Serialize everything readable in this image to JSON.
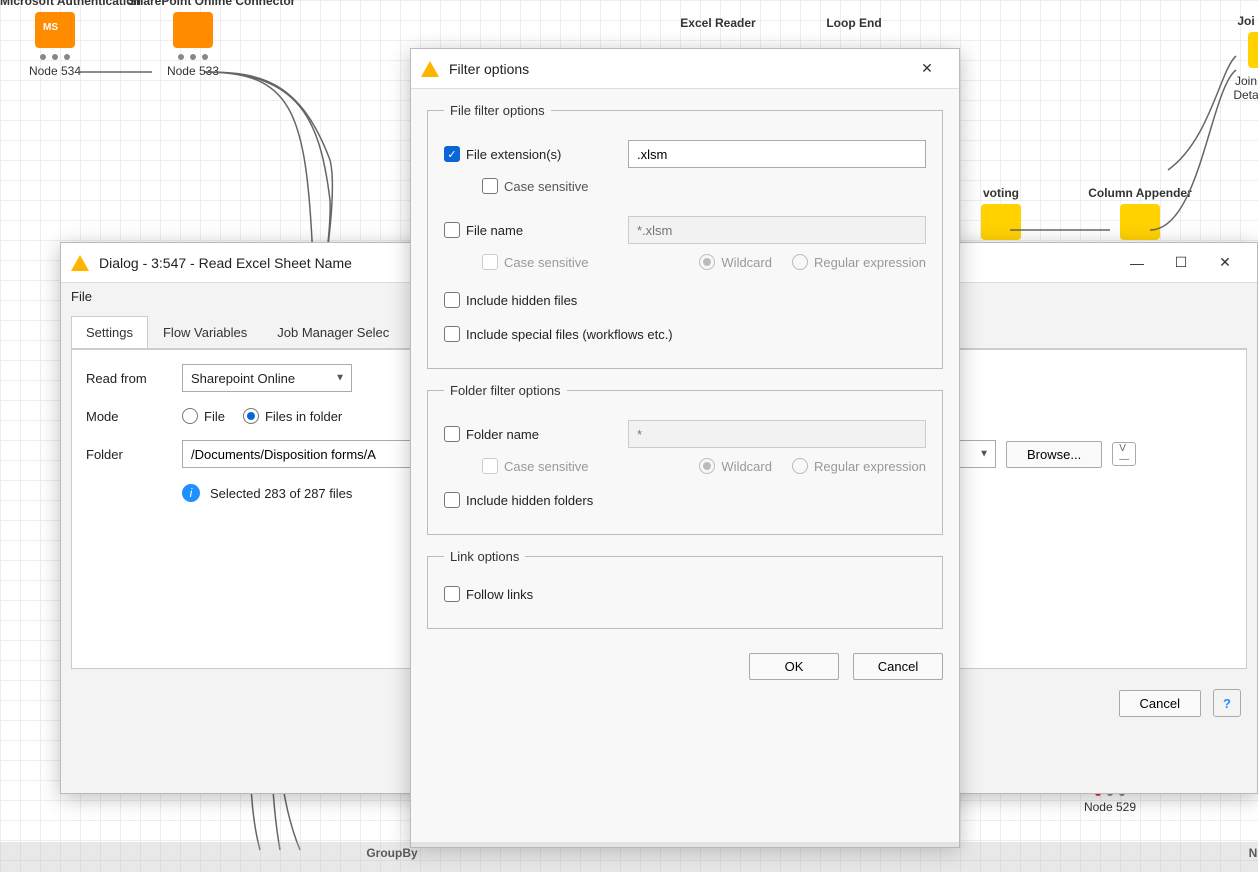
{
  "background_nodes": {
    "n1": {
      "title": "Microsoft\nAuthentication",
      "bottom": "Node 534"
    },
    "n2": {
      "title": "SharePoint\nOnline Connector",
      "bottom": "Node 533"
    },
    "n3": {
      "title": "Excel Reader",
      "bottom": ""
    },
    "n4": {
      "title": "Loop End",
      "bottom": ""
    },
    "n5": {
      "title": "voting",
      "bottom": ""
    },
    "n6": {
      "title": "Column Appender",
      "bottom": ""
    },
    "n7": {
      "title": "Joi",
      "bottom": "Join\nDeta"
    },
    "n8": {
      "title": "",
      "bottom": "Node 529"
    },
    "n9": {
      "title": "GroupBy",
      "bottom": ""
    },
    "n10": {
      "bottom": "N"
    }
  },
  "parent_dialog": {
    "title": "Dialog - 3:547 - Read Excel Sheet Name",
    "menu_file": "File",
    "tabs": {
      "settings": "Settings",
      "flow_vars": "Flow Variables",
      "job_mgr": "Job Manager Selec"
    },
    "read_from_label": "Read from",
    "read_from_value": "Sharepoint Online",
    "mode_label": "Mode",
    "mode_file": "File",
    "mode_files_in_folder": "Files in folder",
    "folder_label": "Folder",
    "folder_value": "/Documents/Disposition forms/A",
    "selected_status": "Selected 283 of 287 files",
    "browse_btn": "Browse...",
    "cancel_btn": "Cancel"
  },
  "filter_dialog": {
    "title": "Filter options",
    "file_group": "File filter options",
    "chk_file_ext": "File extension(s)",
    "file_ext_value": ".xlsm",
    "chk_case1": "Case sensitive",
    "chk_file_name": "File name",
    "file_name_placeholder": "*.xlsm",
    "chk_case2": "Case sensitive",
    "wildcard": "Wildcard",
    "regex": "Regular expression",
    "chk_hidden_files": "Include hidden files",
    "chk_special": "Include special files (workflows etc.)",
    "folder_group": "Folder filter options",
    "chk_folder_name": "Folder name",
    "folder_name_placeholder": "*",
    "chk_hidden_folders": "Include hidden folders",
    "link_group": "Link options",
    "chk_follow_links": "Follow links",
    "ok_btn": "OK",
    "cancel_btn": "Cancel"
  }
}
